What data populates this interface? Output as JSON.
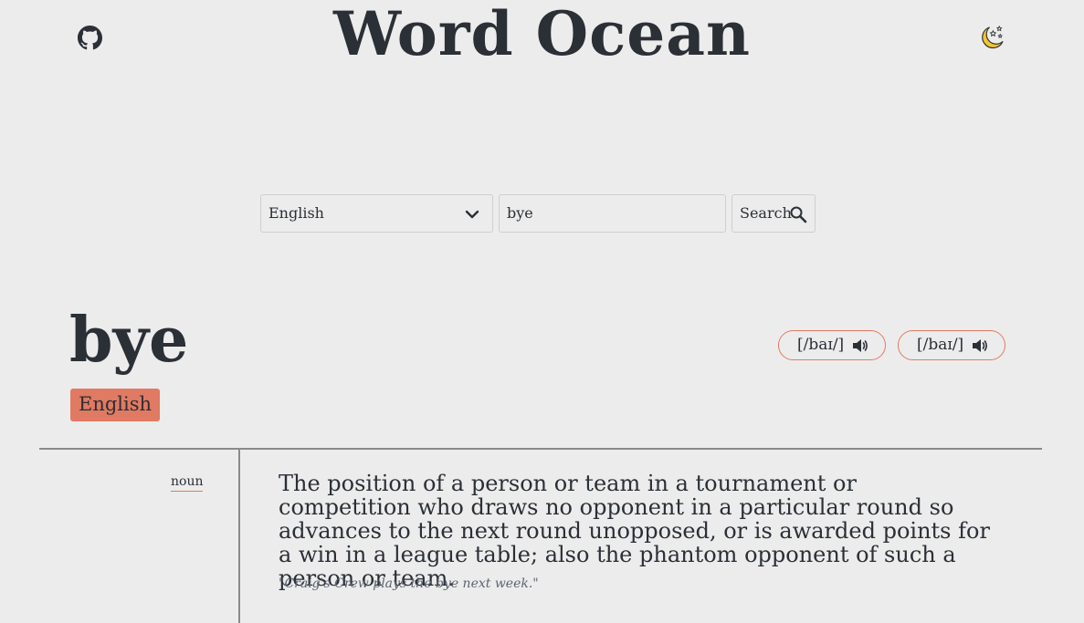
{
  "header": {
    "title": "Word Ocean",
    "github_icon": "github-icon",
    "theme_icon": "moon-stars-icon"
  },
  "search": {
    "language_selected": "English",
    "query_value": "bye",
    "button_label": "Search",
    "button_icon": "search-icon"
  },
  "entry": {
    "word": "bye",
    "language": "English",
    "pronunciations": [
      {
        "text": "[/baɪ/]",
        "icon": "speaker-icon"
      },
      {
        "text": "[/baɪ/]",
        "icon": "speaker-icon"
      }
    ],
    "meanings": [
      {
        "part_of_speech": "noun",
        "definition": "The position of a person or team in a tournament or competition who draws no opponent in a particular round so advances to the next round unopposed, or is awarded points for a win in a league table; also the phantom opponent of such a person or team.",
        "example": "\"Craig's Crew plays the bye next week.\""
      }
    ]
  },
  "colors": {
    "background": "#ececec",
    "text": "#2b2f36",
    "accent": "#e07a62",
    "moon": "#f2c531"
  }
}
